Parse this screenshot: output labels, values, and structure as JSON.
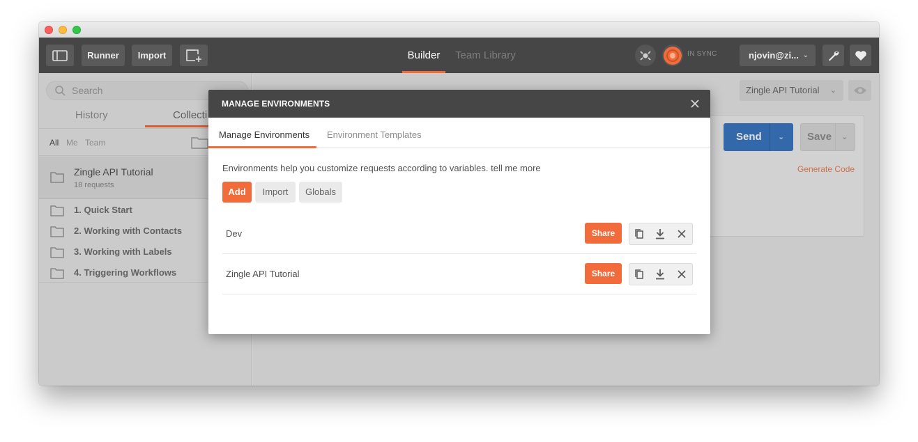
{
  "header": {
    "runner_label": "Runner",
    "import_label": "Import",
    "tabs": [
      {
        "label": "Builder",
        "active": true
      },
      {
        "label": "Team Library",
        "active": false
      }
    ],
    "sync_status": "IN SYNC",
    "user_label": "njovin@zi...",
    "accent_color": "#f26b3a"
  },
  "sidebar": {
    "search_placeholder": "Search",
    "tabs": [
      "History",
      "Collecti"
    ],
    "filters": [
      "All",
      "Me",
      "Team"
    ],
    "collection": {
      "title": "Zingle API Tutorial",
      "subtitle": "18 requests"
    },
    "folders": [
      "1. Quick Start",
      "2. Working with Contacts",
      "3. Working with Labels",
      "4. Triggering Workflows"
    ]
  },
  "main": {
    "environment_selected": "Zingle API Tutorial",
    "send_label": "Send",
    "save_label": "Save",
    "generate_code_label": "Generate Code"
  },
  "modal": {
    "title": "MANAGE ENVIRONMENTS",
    "tabs": [
      {
        "label": "Manage Environments",
        "active": true
      },
      {
        "label": "Environment Templates",
        "active": false
      }
    ],
    "help_text": "Environments help you customize requests according to variables. tell me more",
    "buttons": {
      "add": "Add",
      "import": "Import",
      "globals": "Globals"
    },
    "environments": [
      {
        "name": "Dev",
        "share_label": "Share"
      },
      {
        "name": "Zingle API Tutorial",
        "share_label": "Share"
      }
    ]
  }
}
